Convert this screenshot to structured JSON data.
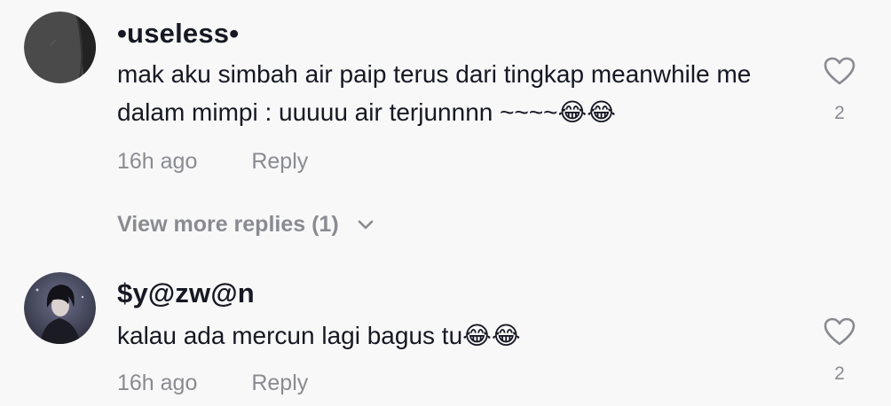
{
  "comments": [
    {
      "username": "•useless•",
      "text": "mak aku simbah air paip terus dari tingkap meanwhile me dalam mimpi : uuuuu air terjunnnn ~~~~😂😂",
      "time": "16h ago",
      "reply_label": "Reply",
      "like_count": "2",
      "avatar_icon": "avatar-dark-gray",
      "heart_icon": "heart-outline-icon"
    },
    {
      "username": "$y@zw@n",
      "text": "kalau ada mercun lagi bagus tu😂😂",
      "time": "16h ago",
      "reply_label": "Reply",
      "like_count": "2",
      "avatar_icon": "avatar-anime-character",
      "heart_icon": "heart-outline-icon"
    }
  ],
  "view_more": {
    "label": "View more replies (1)",
    "icon": "chevron-down-icon"
  },
  "colors": {
    "background": "#f8f8f8",
    "text_primary": "#161823",
    "text_secondary": "#8a8b91"
  }
}
